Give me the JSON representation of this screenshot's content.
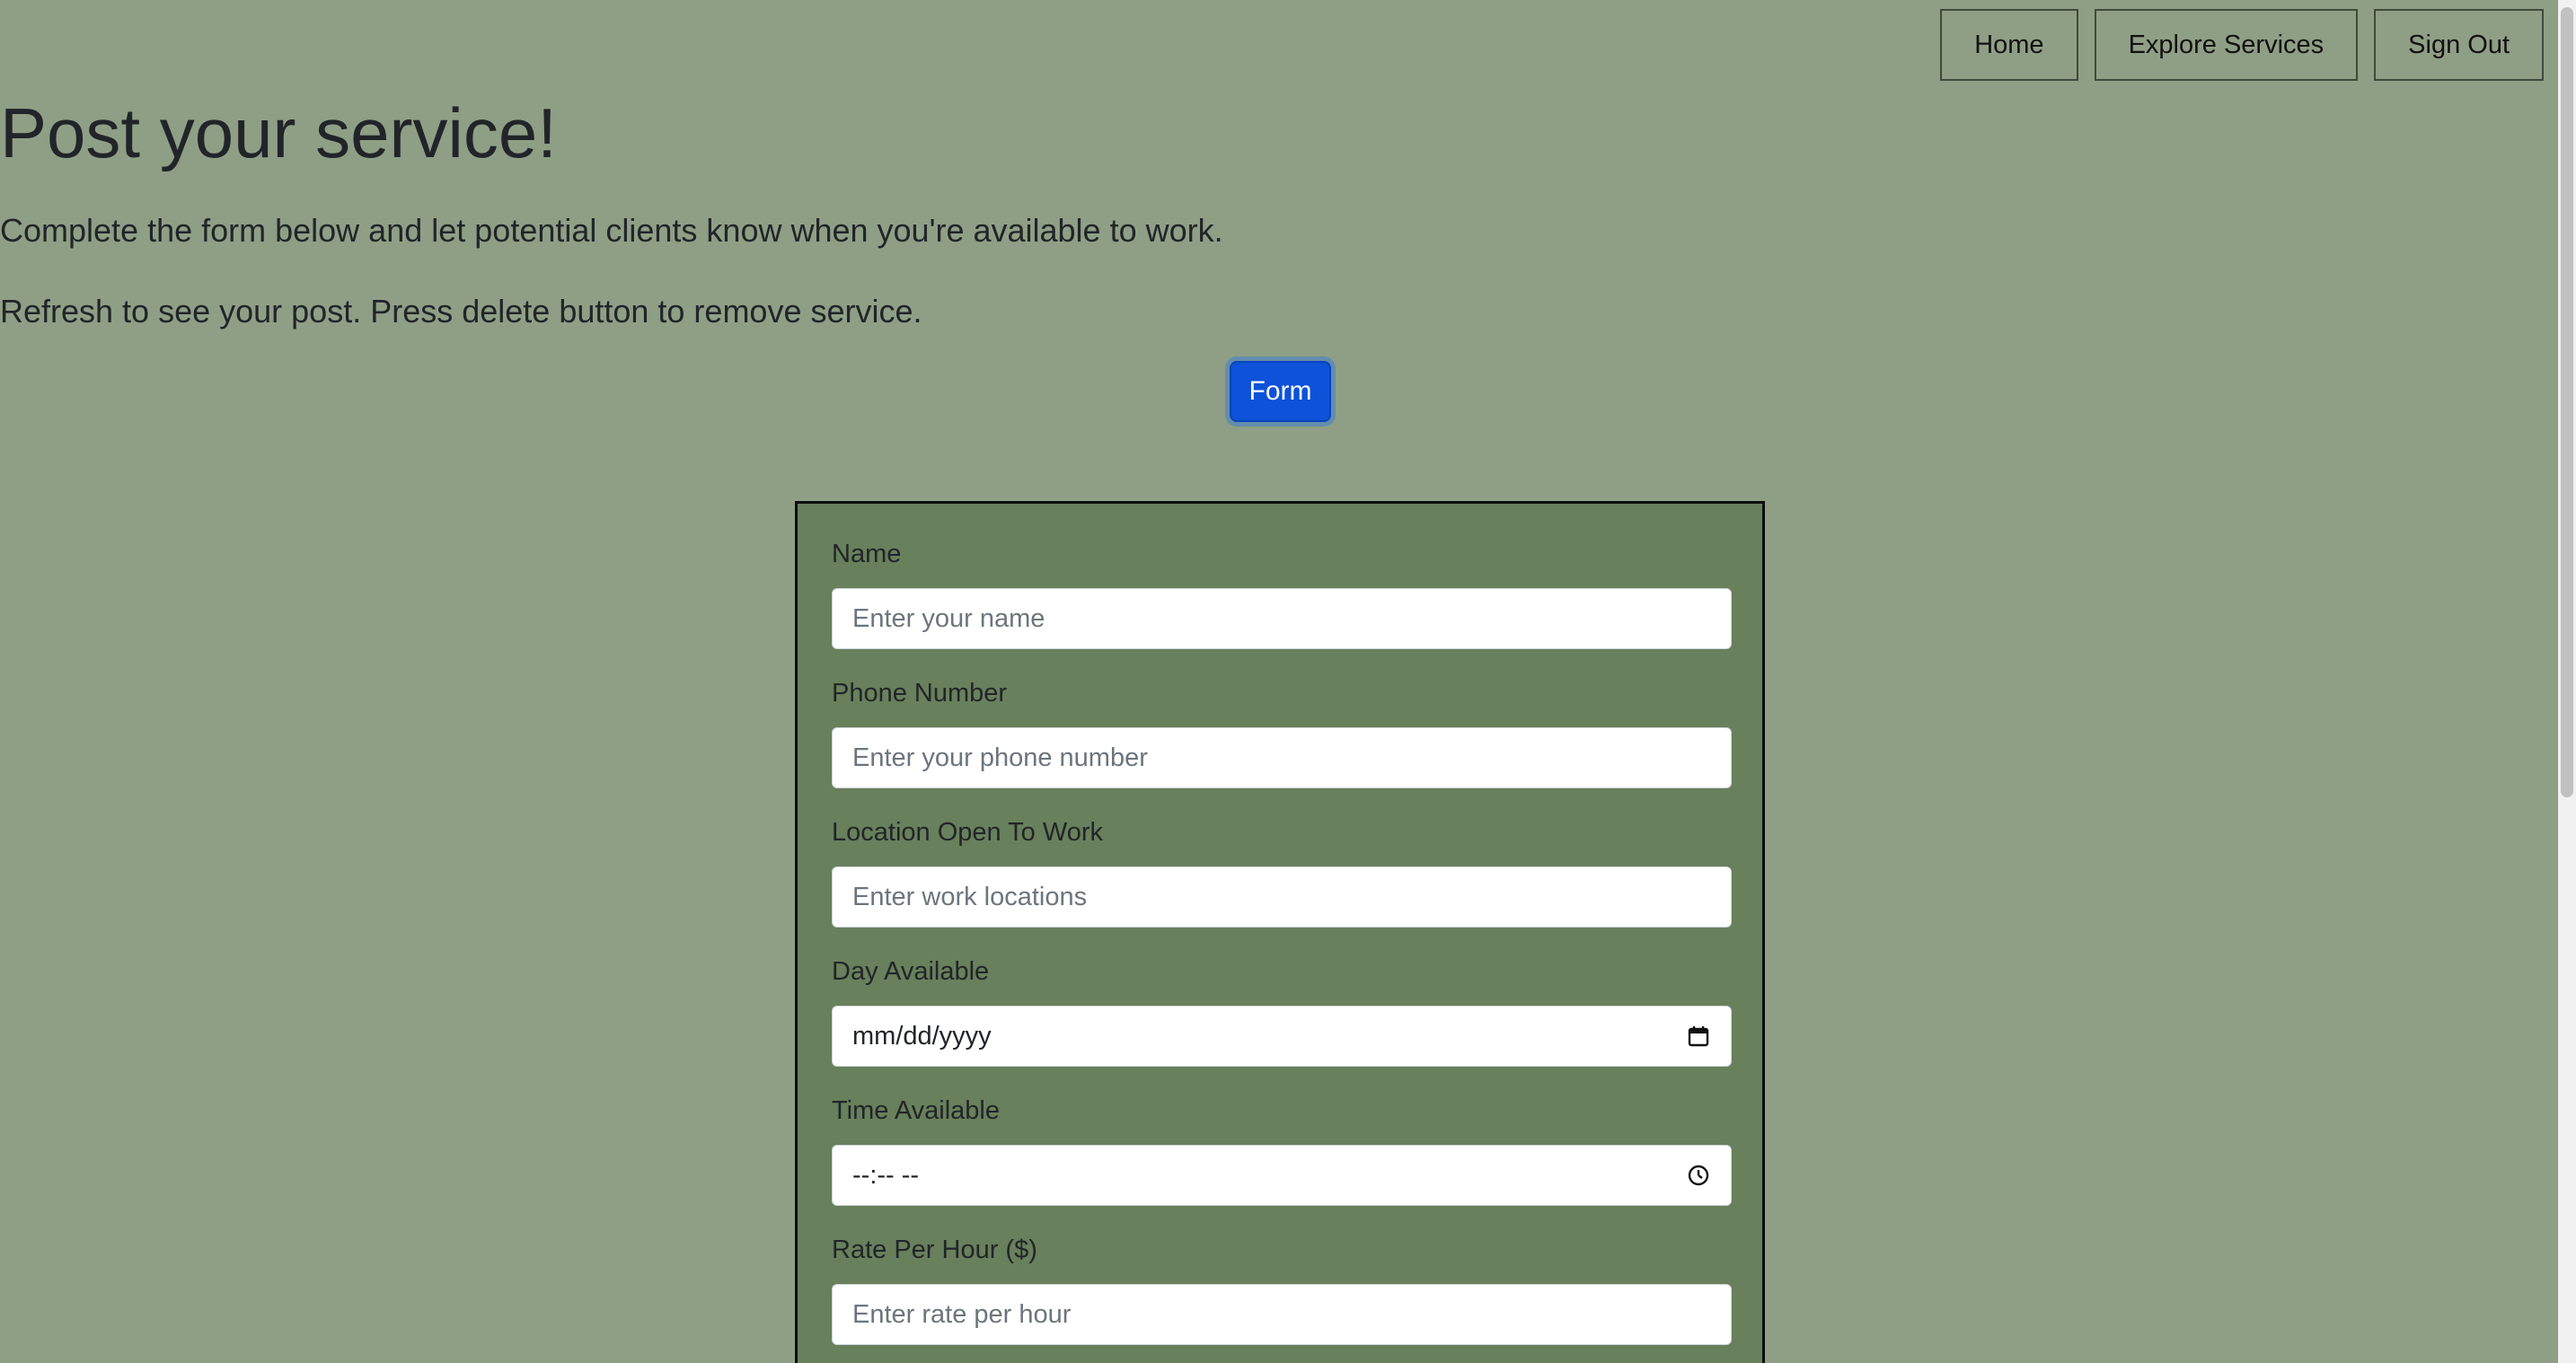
{
  "nav": {
    "home_label": "Home",
    "explore_label": "Explore Services",
    "signout_label": "Sign Out"
  },
  "header": {
    "title": "Post your service!",
    "lead_1": "Complete the form below and let potential clients know when you're available to work.",
    "lead_2": "Refresh to see your post. Press delete button to remove service."
  },
  "form_toggle_label": "Form",
  "form": {
    "fields": [
      {
        "label": "Name",
        "placeholder": "Enter your name"
      },
      {
        "label": "Phone Number",
        "placeholder": "Enter your phone number"
      },
      {
        "label": "Location Open To Work",
        "placeholder": "Enter work locations"
      },
      {
        "label": "Day Available",
        "value": "mm/dd/yyyy",
        "icon": "calendar-icon"
      },
      {
        "label": "Time Available",
        "value": "--:-- --",
        "icon": "clock-icon"
      },
      {
        "label": "Rate Per Hour ($)",
        "placeholder": "Enter rate per hour"
      }
    ]
  },
  "colors": {
    "page_bg": "#8f9f85",
    "form_bg": "#68805b",
    "primary": "#0d52d8"
  }
}
